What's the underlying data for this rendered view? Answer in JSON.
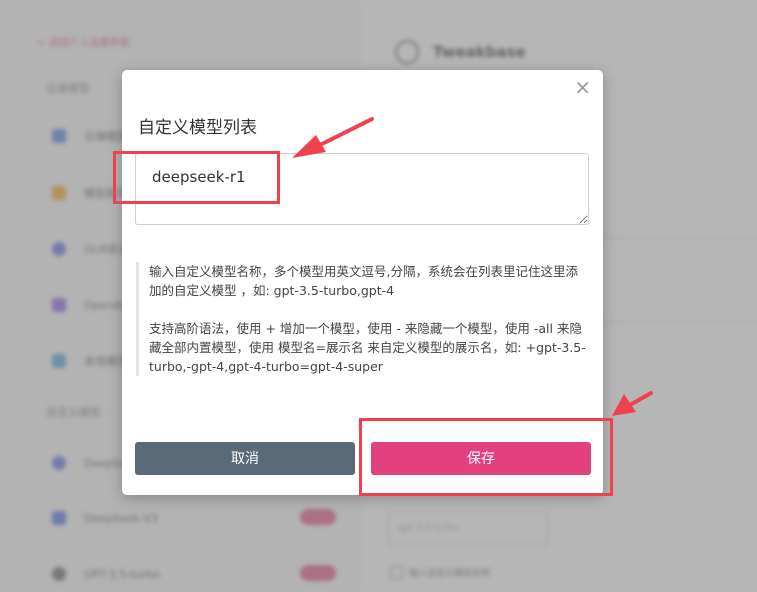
{
  "background": {
    "back_link": "← 返回个人设置界面",
    "section1": "云端模型",
    "items1": [
      "云端模型",
      "模型服务",
      "GLM系列",
      "OpenAI系列",
      "本地模型"
    ],
    "section2": "自定义模型",
    "items2": [
      "DeepSeek-V3",
      "GPT-3.5-turbo"
    ],
    "page_title": "Tweakbase",
    "input_placeholder": "gpt-3.5-turbo",
    "checkbox_label": "输入自定义模型名称"
  },
  "modal": {
    "title": "自定义模型列表",
    "close_glyph": "×",
    "textarea_value": "deepseek-r1",
    "help_paragraph_1": "输入自定义模型名称，多个模型用英文逗号,分隔，系统会在列表里记住这里添加的自定义模型 ，如: gpt-3.5-turbo,gpt-4",
    "help_paragraph_2": "支持高阶语法，使用 + 增加一个模型，使用 - 来隐藏一个模型，使用 -all 来隐藏全部内置模型，使用 模型名=展示名 来自定义模型的展示名，如: +gpt-3.5-turbo,-gpt-4,gpt-4-turbo=gpt-4-super",
    "cancel_label": "取消",
    "save_label": "保存"
  },
  "colors": {
    "accent": "#e2407e",
    "cancel": "#5a6a78",
    "annotation": "#f0414e"
  }
}
